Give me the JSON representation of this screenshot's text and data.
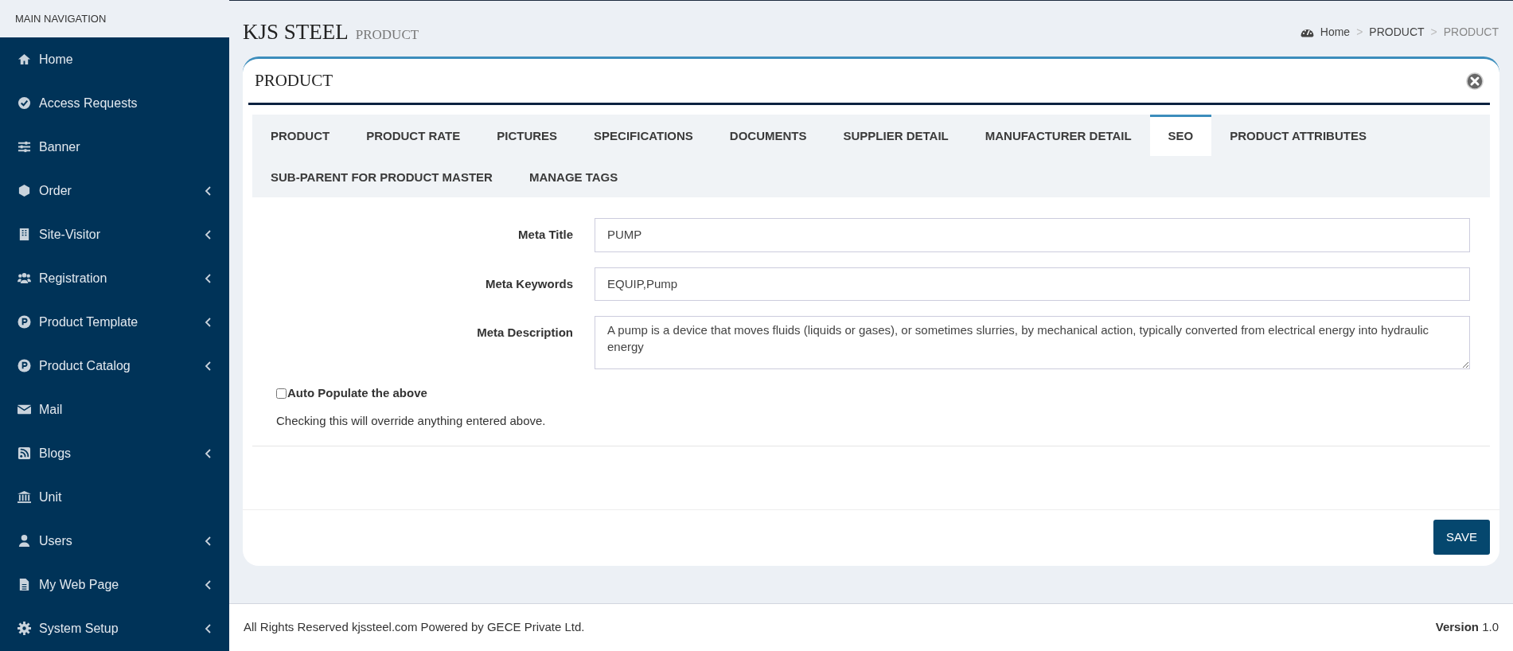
{
  "sidebar": {
    "header": "MAIN NAVIGATION",
    "items": [
      {
        "label": "Home",
        "kind": "link"
      },
      {
        "label": "Access Requests",
        "kind": "link"
      },
      {
        "label": "Banner",
        "kind": "link"
      },
      {
        "label": "Order",
        "kind": "submenu"
      },
      {
        "label": "Site-Visitor",
        "kind": "submenu"
      },
      {
        "label": "Registration",
        "kind": "submenu"
      },
      {
        "label": "Product Template",
        "kind": "submenu"
      },
      {
        "label": "Product Catalog",
        "kind": "submenu"
      },
      {
        "label": "Mail",
        "kind": "link"
      },
      {
        "label": "Blogs",
        "kind": "submenu"
      },
      {
        "label": "Unit",
        "kind": "link"
      },
      {
        "label": "Users",
        "kind": "submenu"
      },
      {
        "label": "My Web Page",
        "kind": "submenu"
      },
      {
        "label": "System Setup",
        "kind": "submenu"
      }
    ]
  },
  "page_header": {
    "title": "KJS STEEL",
    "subtitle": "PRODUCT"
  },
  "breadcrumb": [
    {
      "label": "Home",
      "active": false
    },
    {
      "label": "PRODUCT",
      "active": false
    },
    {
      "label": "PRODUCT",
      "active": true
    }
  ],
  "breadcrumb_separator": ">",
  "card": {
    "title": "PRODUCT",
    "tabs": [
      {
        "label": "PRODUCT",
        "selected": false
      },
      {
        "label": "PRODUCT RATE",
        "selected": false
      },
      {
        "label": "PICTURES",
        "selected": false
      },
      {
        "label": "SPECIFICATIONS",
        "selected": false
      },
      {
        "label": "DOCUMENTS",
        "selected": false
      },
      {
        "label": "SUPPLIER DETAIL",
        "selected": false
      },
      {
        "label": "MANUFACTURER DETAIL",
        "selected": false
      },
      {
        "label": "SEO",
        "selected": true
      },
      {
        "label": "PRODUCT ATTRIBUTES",
        "selected": false
      },
      {
        "label": "SUB-PARENT FOR PRODUCT MASTER",
        "selected": false
      },
      {
        "label": "MANAGE TAGS",
        "selected": false
      }
    ],
    "fields": [
      {
        "label": "Meta Title",
        "kind": "input",
        "value": "PUMP"
      },
      {
        "label": "Meta Keywords",
        "kind": "input",
        "value": "EQUIP,Pump"
      },
      {
        "label": "Meta Description",
        "kind": "textarea",
        "value": "A pump is a device that moves fluids (liquids or gases), or sometimes slurries, by mechanical action, typically converted from electrical energy into hydraulic energy"
      }
    ],
    "auto_populate": {
      "label": "Auto Populate the above",
      "checked": false,
      "help": "Checking this will override anything entered above."
    },
    "save_button": "SAVE"
  },
  "footer": {
    "text": "All Rights Reserved kjssteel.com Powered by GECE Private Ltd.",
    "version_label": "Version",
    "version": "1.0"
  }
}
